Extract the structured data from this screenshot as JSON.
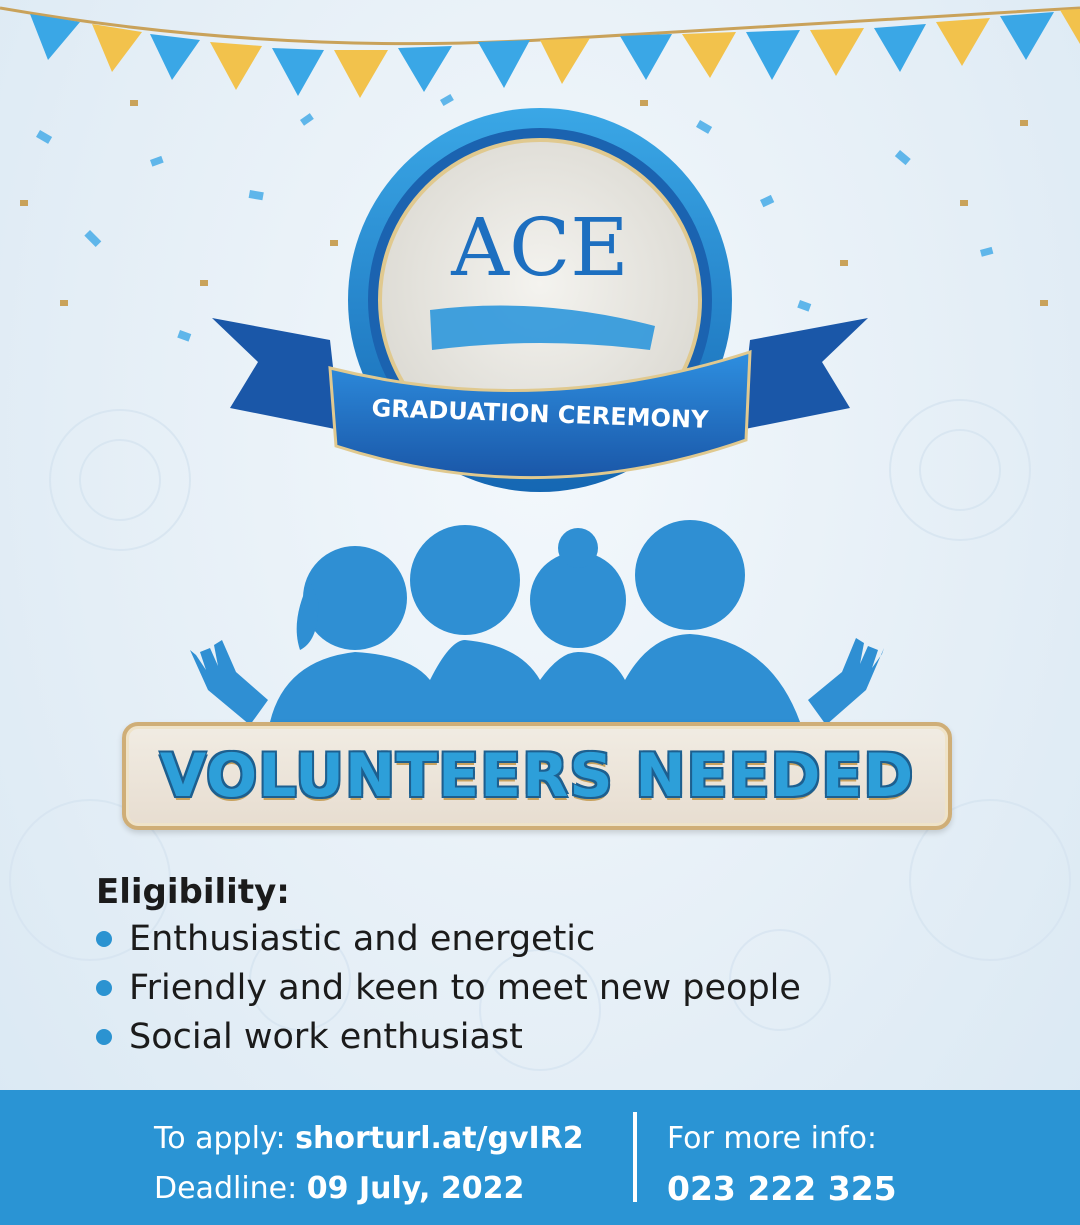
{
  "logo": {
    "brand": "ACE",
    "banner": "GRADUATION CEREMONY"
  },
  "headline": "VOLUNTEERS NEEDED",
  "eligibility": {
    "title": "Eligibility:",
    "items": [
      "Enthusiastic and energetic",
      "Friendly and keen to meet new people",
      "Social work enthusiast"
    ]
  },
  "footer": {
    "apply_label": "To apply:",
    "apply_value": "shorturl.at/gvIR2",
    "deadline_label": "Deadline:",
    "deadline_value": "09 July, 2022",
    "info_label": "For more info:",
    "info_value": "023 222 325"
  },
  "colors": {
    "primary_blue": "#2a94d4",
    "dark_blue": "#1d5f8f",
    "gold": "#cfae77",
    "background": "#e4eef6"
  }
}
